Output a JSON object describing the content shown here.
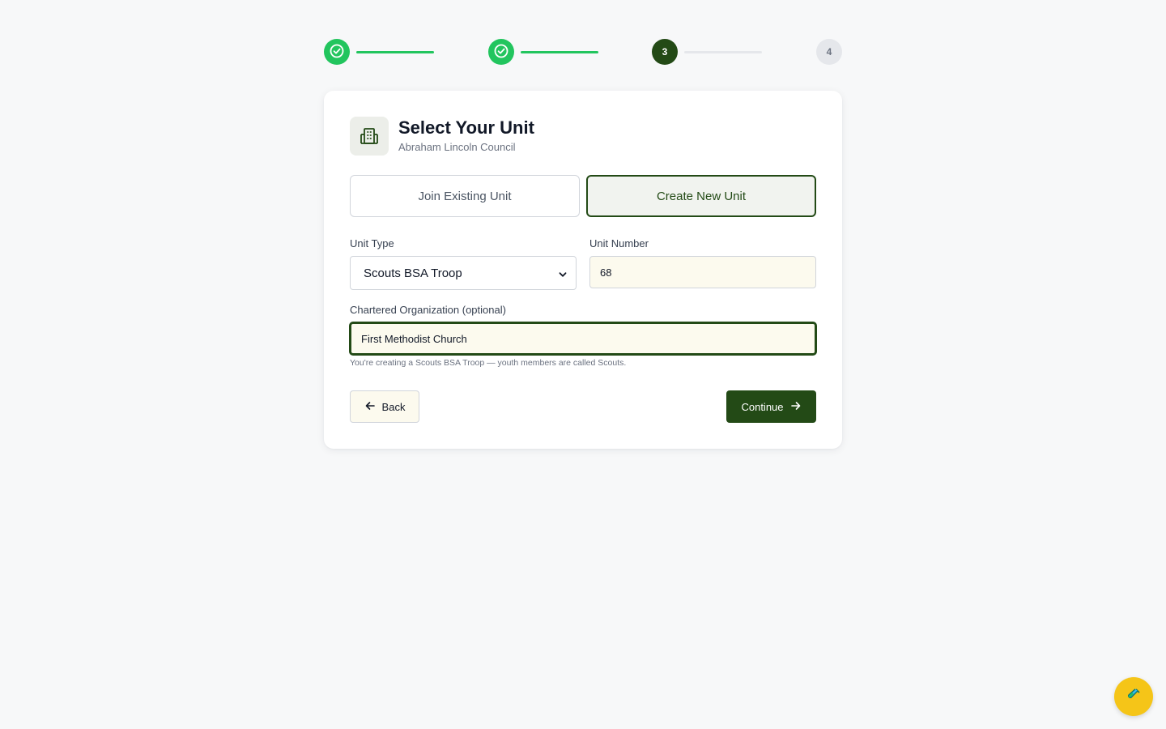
{
  "stepper": {
    "steps": [
      {
        "label": "",
        "state": "done"
      },
      {
        "label": "",
        "state": "done"
      },
      {
        "label": "3",
        "state": "current"
      },
      {
        "label": "4",
        "state": "todo"
      }
    ]
  },
  "header": {
    "icon": "building-icon",
    "title": "Select Your Unit",
    "subtitle": "Abraham Lincoln Council"
  },
  "mode": {
    "join_label": "Join Existing Unit",
    "create_label": "Create New Unit",
    "selected": "create"
  },
  "form": {
    "unit_type_label": "Unit Type",
    "unit_type_value": "Scouts BSA Troop",
    "unit_number_label": "Unit Number",
    "unit_number_value": "68",
    "org_label": "Chartered Organization (optional)",
    "org_value": "First Methodist Church",
    "hint": "You're creating a Scouts BSA Troop — youth members are called Scouts."
  },
  "actions": {
    "back_label": "Back",
    "continue_label": "Continue"
  },
  "fab": {
    "icon": "test-tube-icon"
  },
  "colors": {
    "primary": "#234a16",
    "success": "#22c55e",
    "input_bg": "#fcfaee",
    "fab": "#f5c518"
  }
}
